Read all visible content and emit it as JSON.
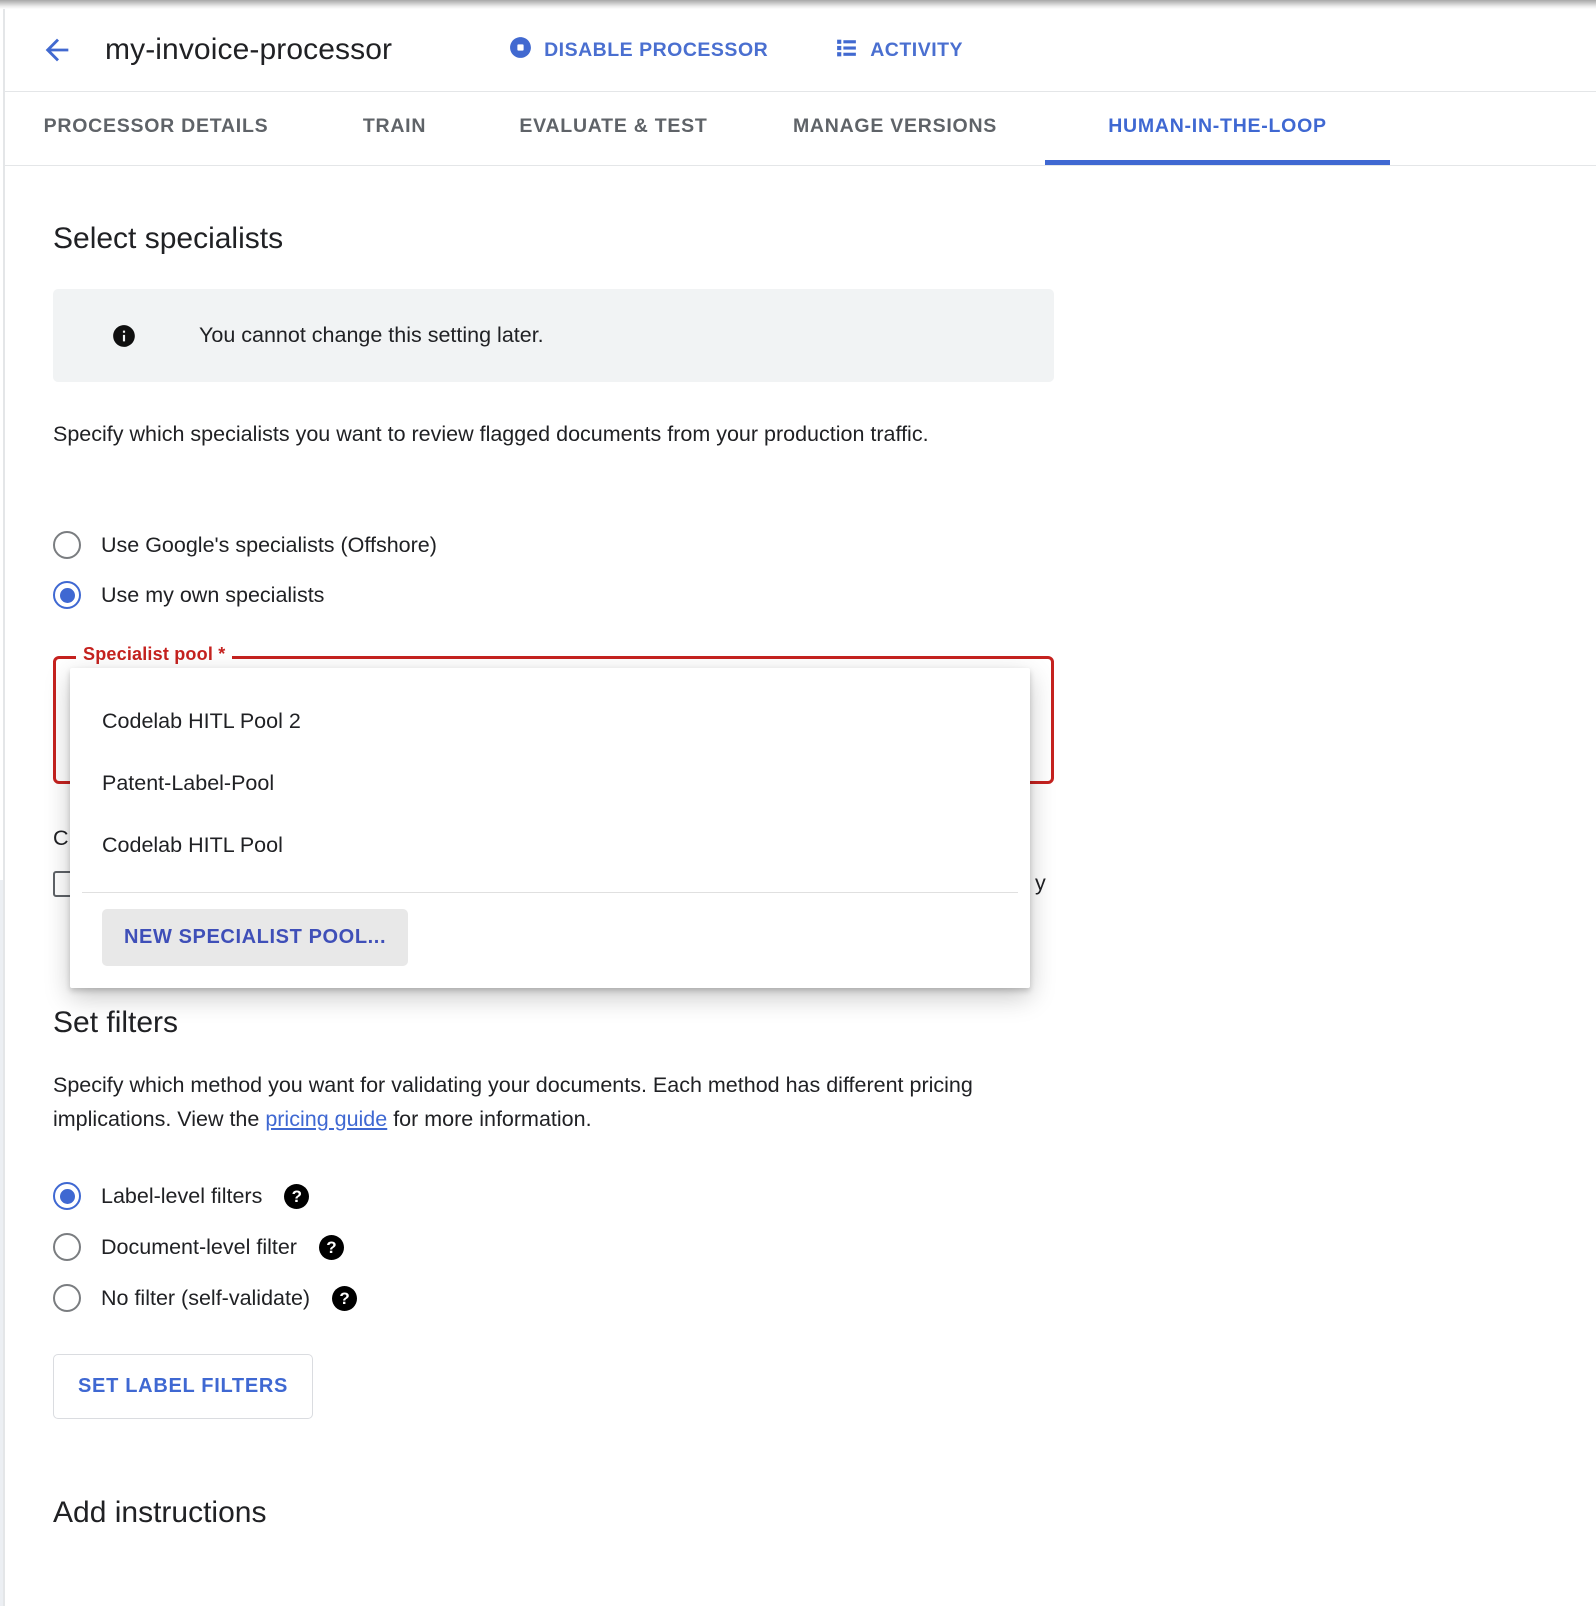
{
  "header": {
    "back_icon": "arrow-back-icon",
    "title": "my-invoice-processor",
    "actions": [
      {
        "label": "DISABLE PROCESSOR",
        "icon": "stop-circle-icon"
      },
      {
        "label": "ACTIVITY",
        "icon": "list-view-icon"
      }
    ]
  },
  "tabs": [
    {
      "label": "PROCESSOR DETAILS",
      "active": false
    },
    {
      "label": "TRAIN",
      "active": false
    },
    {
      "label": "EVALUATE & TEST",
      "active": false
    },
    {
      "label": "MANAGE VERSIONS",
      "active": false
    },
    {
      "label": "HUMAN-IN-THE-LOOP",
      "active": true
    }
  ],
  "select_specialists": {
    "heading": "Select specialists",
    "info_banner": {
      "icon": "info-icon",
      "text": "You cannot change this setting later."
    },
    "description": "Specify which specialists you want to review flagged documents from your production traffic.",
    "options": [
      {
        "label": "Use Google's specialists (Offshore)",
        "selected": false
      },
      {
        "label": "Use my own specialists",
        "selected": true
      }
    ],
    "pool_field": {
      "label": "Specialist pool *",
      "value": "",
      "error": true
    },
    "obscured_text_left": "C",
    "obscured_text_right": "y"
  },
  "dropdown": {
    "options": [
      "Codelab HITL Pool 2",
      "Patent-Label-Pool",
      "Codelab HITL Pool"
    ],
    "new_pool_button": "NEW SPECIALIST POOL..."
  },
  "set_filters": {
    "heading": "Set filters",
    "description_part1": "Specify which method you want for validating your documents. Each method has different pricing implications. View the ",
    "link_text": "pricing guide",
    "description_part2": " for more information.",
    "options": [
      {
        "label": "Label-level filters",
        "selected": true,
        "help": "help-icon"
      },
      {
        "label": "Document-level filter",
        "selected": false,
        "help": "help-icon"
      },
      {
        "label": "No filter (self-validate)",
        "selected": false,
        "help": "help-icon"
      }
    ],
    "button": "SET LABEL FILTERS"
  },
  "add_instructions": {
    "heading": "Add instructions"
  },
  "colors": {
    "accent_blue": "#3f68d2",
    "error_red": "#c5221f",
    "text_primary": "#202124",
    "text_secondary": "#5f6368",
    "banner_bg": "#f1f3f4"
  }
}
